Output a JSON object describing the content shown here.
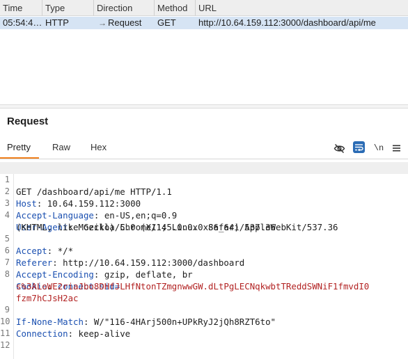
{
  "history": {
    "columns": [
      "Time",
      "Type",
      "Direction",
      "Method",
      "URL"
    ],
    "row": {
      "time": "05:54:4…",
      "type": "HTTP",
      "direction": "Request",
      "method": "GET",
      "url": "http://10.64.159.112:3000/dashboard/api/me"
    }
  },
  "request": {
    "title": "Request",
    "tabs": [
      "Pretty",
      "Raw",
      "Hex"
    ],
    "newline_label": "\\n",
    "lines": [
      {
        "num": "1",
        "text": "GET /dashboard/api/me HTTP/1.1"
      },
      {
        "num": "2",
        "key": "Host",
        "value": "10.64.159.112:3000"
      },
      {
        "num": "3",
        "key": "Accept-Language",
        "value": "en-US,en;q=0.9"
      },
      {
        "num": "4",
        "key": "User-Agent",
        "value": "Mozilla/5.0 (X11; Linux x86_64) AppleWebKit/537.36",
        "cont": "(KHTML, like Gecko) Chrome/145.0.0.0 Safari/537.36"
      },
      {
        "num": "5",
        "key": "Accept",
        "value": "*/*"
      },
      {
        "num": "6",
        "key": "Referer",
        "value": "http://10.64.159.112:3000/dashboard"
      },
      {
        "num": "7",
        "key": "Accept-Encoding",
        "value": "gzip, deflate, br"
      },
      {
        "num": "8",
        "key": "Cookie",
        "cookie_name": "connect.sid=",
        "cookie_value_1": "s%3ALoWE2riaJbo8DHfJLHfNtonTZmgnwwGW.dLtPgLECNqkwbtTReddSWNiF1fmvdI0",
        "cookie_value_2": "fzm7hCJsH2ac"
      },
      {
        "num": "9",
        "key": "If-None-Match",
        "value": "W/\"116-4HArj500n+UPkRyJ2jQh8RZT6to\""
      },
      {
        "num": "10",
        "key": "Connection",
        "value": "keep-alive"
      },
      {
        "num": "11"
      },
      {
        "num": "12"
      }
    ]
  },
  "colors": {
    "selected_row": "#d6e4f4",
    "header_key": "#1a4fb0",
    "cookie_value": "#b22222",
    "active_tab_underline": "#f07f1c",
    "wrap_toggle_active": "#2b6cb5"
  },
  "icons": [
    "arrow-right-icon",
    "eye-slash-icon",
    "word-wrap-icon",
    "newline-icon",
    "menu-icon"
  ]
}
